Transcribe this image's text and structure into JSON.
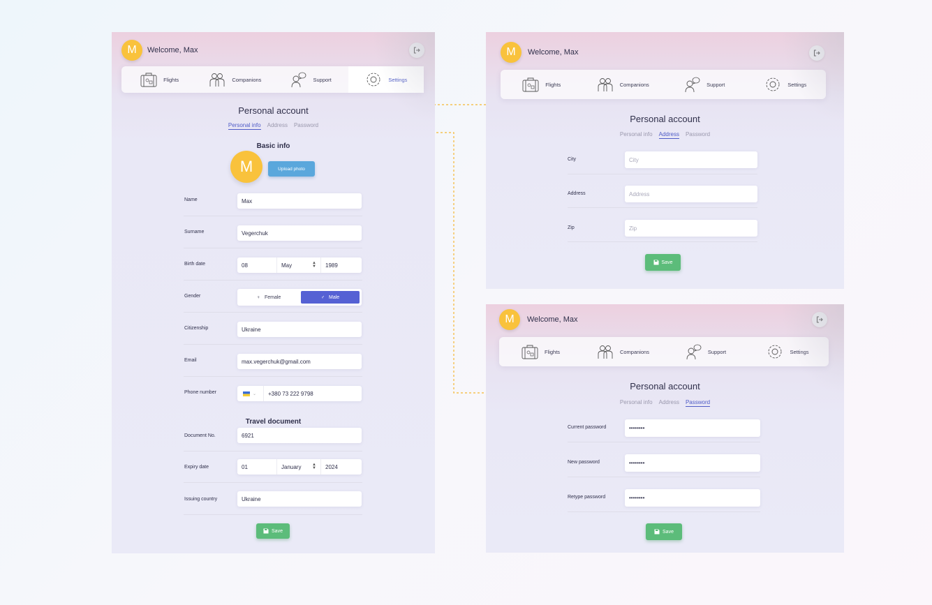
{
  "user": {
    "initial": "M",
    "welcome": "Welcome, Max"
  },
  "nav": {
    "flights": "Flights",
    "companions": "Companions",
    "support": "Support",
    "settings": "Settings"
  },
  "page": {
    "title": "Personal account",
    "tabs": {
      "personal": "Personal info",
      "address": "Address",
      "password": "Password"
    }
  },
  "personal": {
    "section_basic": "Basic info",
    "upload_photo": "Upload photo",
    "name_label": "Name",
    "name_value": "Max",
    "surname_label": "Surname",
    "surname_value": "Vegerchuk",
    "birth_label": "Birth date",
    "birth_day": "08",
    "birth_month": "May",
    "birth_year": "1989",
    "gender_label": "Gender",
    "gender_female": "Female",
    "gender_male": "Male",
    "gender_selected": "Male",
    "citizenship_label": "Citizenship",
    "citizenship_value": "Ukraine",
    "email_label": "Email",
    "email_value": "max.vegerchuk@gmail.com",
    "phone_label": "Phone number",
    "phone_value": "+380 73 222 9798",
    "section_travel": "Travel document",
    "document_label": "Document No.",
    "document_value": "6921",
    "expiry_label": "Expiry date",
    "expiry_day": "01",
    "expiry_month": "January",
    "expiry_year": "2024",
    "issuing_label": "Issuing country",
    "issuing_value": "Ukraine",
    "save": "Save"
  },
  "address": {
    "city_label": "City",
    "city_placeholder": "City",
    "address_label": "Address",
    "address_placeholder": "Address",
    "zip_label": "Zip",
    "zip_placeholder": "Zip",
    "save": "Save"
  },
  "password": {
    "current_label": "Current password",
    "current_value": "••••••••",
    "new_label": "New password",
    "new_value": "••••••••",
    "retype_label": "Retype password",
    "retype_value": "••••••••",
    "save": "Save"
  },
  "colors": {
    "accent": "#4e5bc6",
    "avatar": "#f9c23c",
    "upload": "#5aa7dc",
    "save": "#5cbc7a",
    "connector": "#f5b731"
  }
}
